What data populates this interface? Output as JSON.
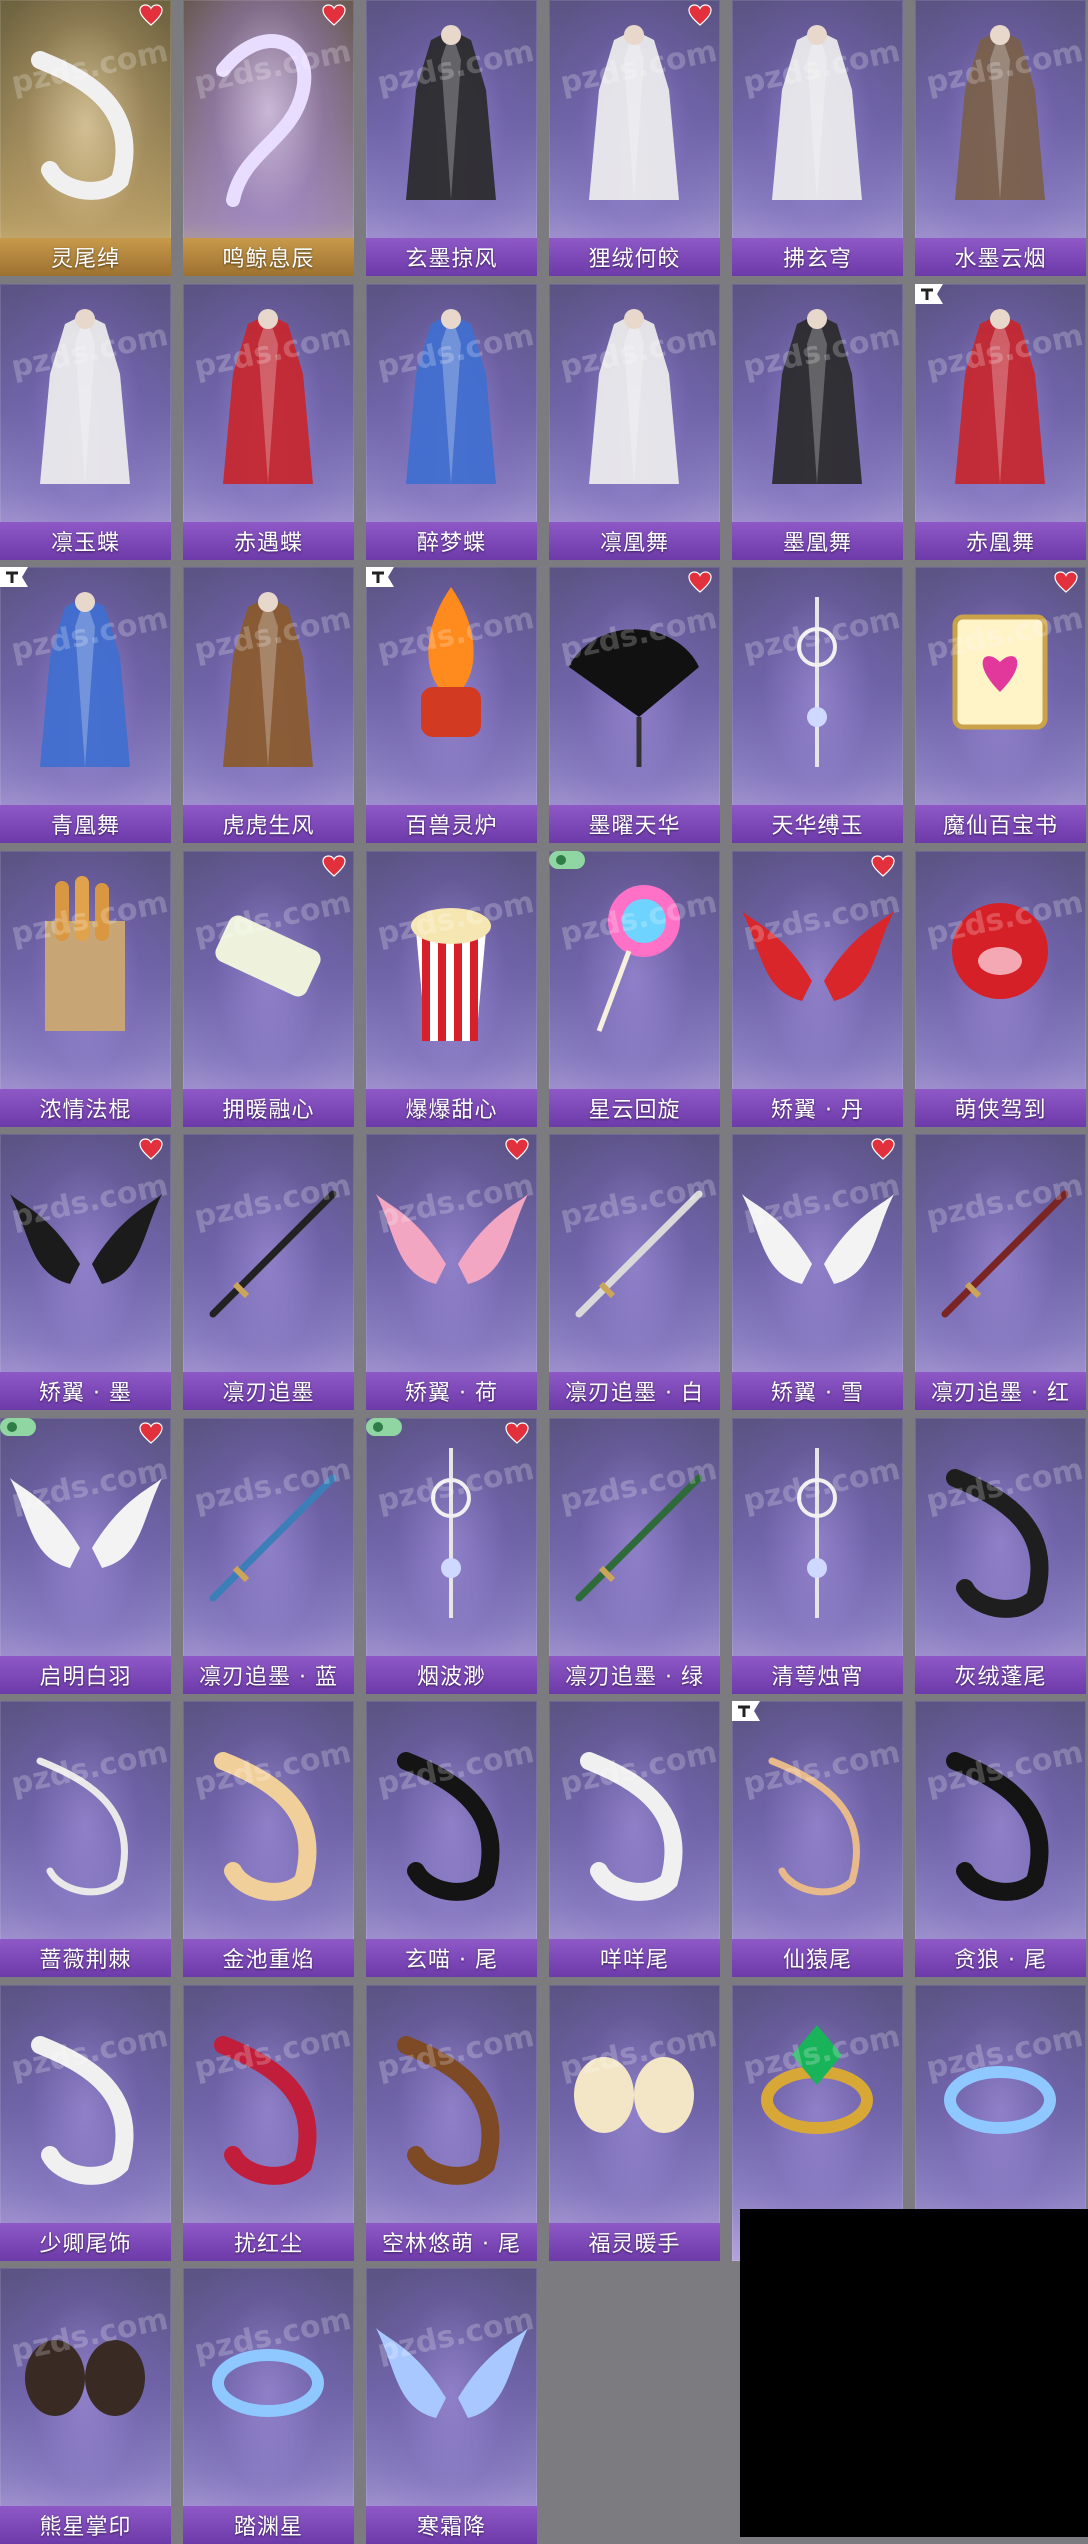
{
  "watermark": "pzds.com",
  "items": [
    {
      "label": "灵尾绰",
      "icon": "fox-tail-ribbon",
      "theme": "gold",
      "fav": true,
      "tag": ""
    },
    {
      "label": "鸣鲸息辰",
      "icon": "spirit-whale",
      "theme": "gold-violet",
      "fav": true,
      "tag": ""
    },
    {
      "label": "玄墨掠风",
      "icon": "black-cloak",
      "theme": "violet",
      "fav": false,
      "tag": ""
    },
    {
      "label": "狸绒何皎",
      "icon": "white-fur-cloak",
      "theme": "violet",
      "fav": true,
      "tag": ""
    },
    {
      "label": "拂玄穹",
      "icon": "white-sash",
      "theme": "violet",
      "fav": false,
      "tag": ""
    },
    {
      "label": "水墨云烟",
      "icon": "ink-cloak",
      "theme": "violet",
      "fav": false,
      "tag": ""
    },
    {
      "label": "凛玉蝶",
      "icon": "white-butterfly-outfit",
      "theme": "violet",
      "fav": false,
      "tag": ""
    },
    {
      "label": "赤遇蝶",
      "icon": "red-butterfly-outfit",
      "theme": "violet",
      "fav": false,
      "tag": ""
    },
    {
      "label": "醉梦蝶",
      "icon": "blue-butterfly-outfit",
      "theme": "violet",
      "fav": false,
      "tag": ""
    },
    {
      "label": "凛凰舞",
      "icon": "white-phoenix-outfit",
      "theme": "violet",
      "fav": false,
      "tag": ""
    },
    {
      "label": "墨凰舞",
      "icon": "black-phoenix-outfit",
      "theme": "violet",
      "fav": false,
      "tag": ""
    },
    {
      "label": "赤凰舞",
      "icon": "red-phoenix-outfit",
      "theme": "violet",
      "fav": false,
      "tag": "t"
    },
    {
      "label": "青凰舞",
      "icon": "blue-phoenix-outfit",
      "theme": "violet",
      "fav": false,
      "tag": "t"
    },
    {
      "label": "虎虎生风",
      "icon": "tiger-costume",
      "theme": "violet",
      "fav": false,
      "tag": ""
    },
    {
      "label": "百兽灵炉",
      "icon": "fire-censer",
      "theme": "violet",
      "fav": false,
      "tag": "t"
    },
    {
      "label": "墨曜天华",
      "icon": "black-feather-fan",
      "theme": "violet",
      "fav": true,
      "tag": ""
    },
    {
      "label": "天华缚玉",
      "icon": "silver-pendant",
      "theme": "violet",
      "fav": false,
      "tag": ""
    },
    {
      "label": "魔仙百宝书",
      "icon": "magic-book",
      "theme": "violet",
      "fav": true,
      "tag": ""
    },
    {
      "label": "浓情法棍",
      "icon": "baguette-bag",
      "theme": "violet",
      "fav": false,
      "tag": ""
    },
    {
      "label": "拥暖融心",
      "icon": "scroll",
      "theme": "violet",
      "fav": true,
      "tag": ""
    },
    {
      "label": "爆爆甜心",
      "icon": "popcorn",
      "theme": "violet",
      "fav": false,
      "tag": ""
    },
    {
      "label": "星云回旋",
      "icon": "lollipop",
      "theme": "violet",
      "fav": false,
      "tag": "v"
    },
    {
      "label": "矫翼 · 丹",
      "icon": "red-wings",
      "theme": "violet",
      "fav": true,
      "tag": ""
    },
    {
      "label": "萌侠驾到",
      "icon": "red-piggy-mask",
      "theme": "violet",
      "fav": false,
      "tag": ""
    },
    {
      "label": "矫翼 · 墨",
      "icon": "black-wings",
      "theme": "violet",
      "fav": true,
      "tag": ""
    },
    {
      "label": "凛刃追墨",
      "icon": "dark-sword",
      "theme": "violet",
      "fav": false,
      "tag": ""
    },
    {
      "label": "矫翼 · 荷",
      "icon": "pink-wings",
      "theme": "violet",
      "fav": true,
      "tag": ""
    },
    {
      "label": "凛刃追墨 · 白",
      "icon": "white-sword",
      "theme": "violet",
      "fav": false,
      "tag": ""
    },
    {
      "label": "矫翼 · 雪",
      "icon": "white-wings",
      "theme": "violet",
      "fav": true,
      "tag": ""
    },
    {
      "label": "凛刃追墨 · 红",
      "icon": "red-sword",
      "theme": "violet",
      "fav": false,
      "tag": ""
    },
    {
      "label": "启明白羽",
      "icon": "white-angel-wings",
      "theme": "violet",
      "fav": true,
      "tag": "v"
    },
    {
      "label": "凛刃追墨 · 蓝",
      "icon": "blue-sword",
      "theme": "violet",
      "fav": false,
      "tag": ""
    },
    {
      "label": "烟波渺",
      "icon": "ribbon-ornament",
      "theme": "violet",
      "fav": true,
      "tag": "v"
    },
    {
      "label": "凛刃追墨 · 绿",
      "icon": "green-sword",
      "theme": "violet",
      "fav": false,
      "tag": ""
    },
    {
      "label": "清萼烛宵",
      "icon": "lotus-staff",
      "theme": "violet",
      "fav": false,
      "tag": ""
    },
    {
      "label": "灰绒蓬尾",
      "icon": "gray-fluffy-tail",
      "theme": "violet",
      "fav": false,
      "tag": ""
    },
    {
      "label": "蔷薇荆棘",
      "icon": "thorn-tail",
      "theme": "violet",
      "fav": false,
      "tag": ""
    },
    {
      "label": "金池重焰",
      "icon": "golden-tail",
      "theme": "violet",
      "fav": false,
      "tag": ""
    },
    {
      "label": "玄喵 · 尾",
      "icon": "black-cat-tail",
      "theme": "violet",
      "fav": false,
      "tag": ""
    },
    {
      "label": "咩咩尾",
      "icon": "sheep-tail",
      "theme": "violet",
      "fav": false,
      "tag": ""
    },
    {
      "label": "仙猿尾",
      "icon": "monkey-tail",
      "theme": "violet",
      "fav": false,
      "tag": "t"
    },
    {
      "label": "贪狼 · 尾",
      "icon": "wolf-tail",
      "theme": "violet",
      "fav": false,
      "tag": ""
    },
    {
      "label": "少卿尾饰",
      "icon": "white-long-tail",
      "theme": "violet",
      "fav": false,
      "tag": ""
    },
    {
      "label": "扰红尘",
      "icon": "red-fluffy-tail",
      "theme": "violet",
      "fav": false,
      "tag": ""
    },
    {
      "label": "空林悠萌 · 尾",
      "icon": "raccoon-tail",
      "theme": "violet",
      "fav": false,
      "tag": ""
    },
    {
      "label": "福灵暖手",
      "icon": "alpaca-gloves",
      "theme": "violet",
      "fav": false,
      "tag": ""
    },
    {
      "label": "",
      "icon": "emerald-ring",
      "theme": "violet",
      "fav": false,
      "tag": ""
    },
    {
      "label": "",
      "icon": "glowing-bracelet",
      "theme": "violet",
      "fav": false,
      "tag": ""
    },
    {
      "label": "熊星掌印",
      "icon": "bear-paw-gloves",
      "theme": "violet",
      "fav": false,
      "tag": ""
    },
    {
      "label": "踏渊星",
      "icon": "starry-ring",
      "theme": "violet",
      "fav": false,
      "tag": ""
    },
    {
      "label": "寒霜降",
      "icon": "frost-wings",
      "theme": "violet",
      "fav": false,
      "tag": ""
    }
  ]
}
